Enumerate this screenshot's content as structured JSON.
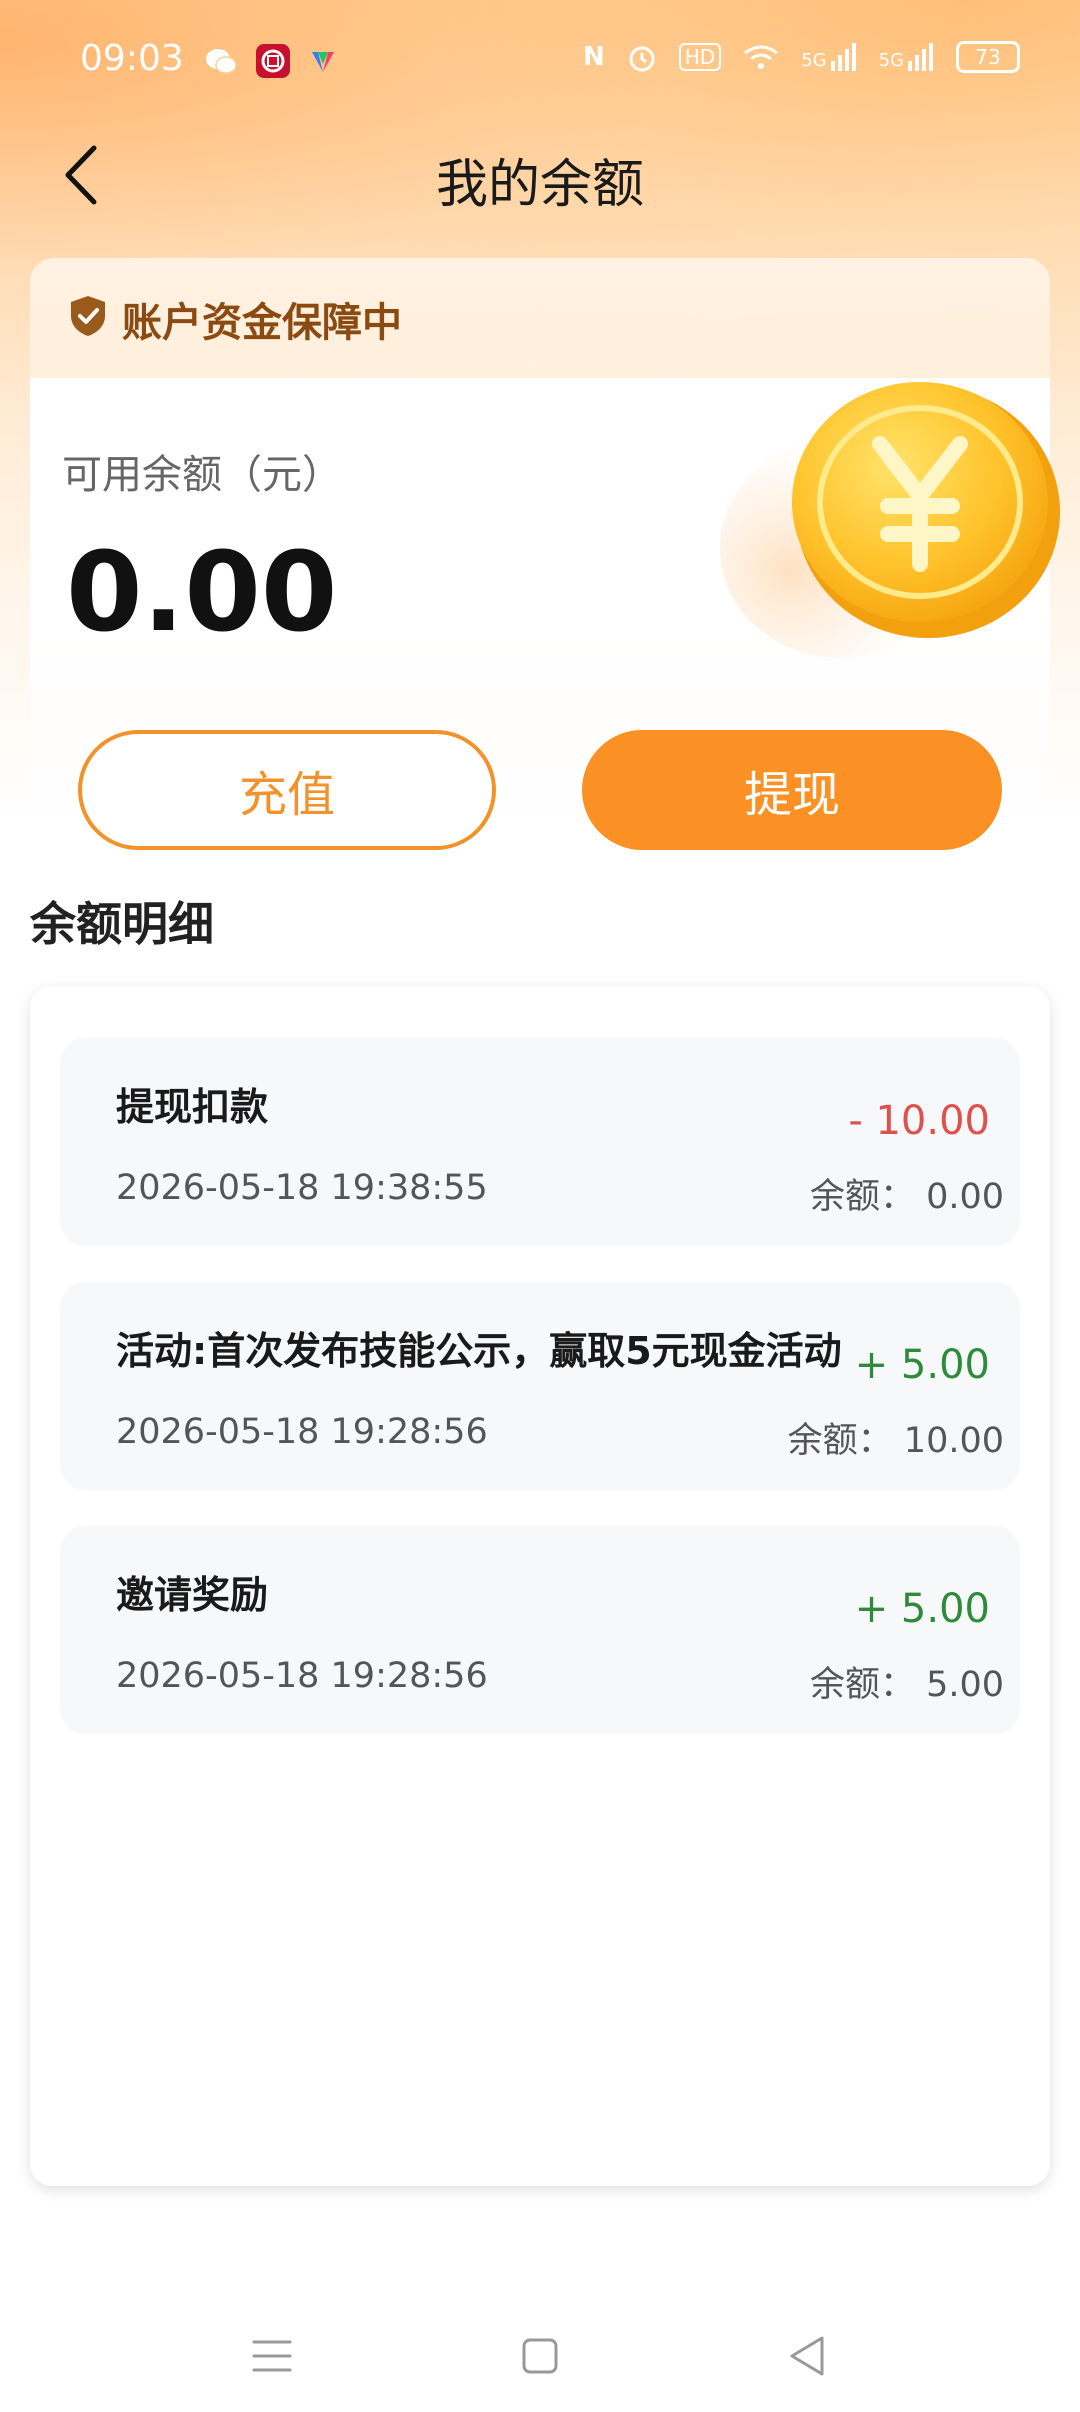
{
  "status_bar": {
    "time": "09:03",
    "battery": "73",
    "icons": [
      "wechat-icon",
      "app-icon",
      "colorful-app-icon",
      "nfc-icon",
      "alarm-icon",
      "hd-icon",
      "wifi-icon",
      "signal-5g-icon",
      "signal-5g-icon"
    ],
    "network_label_1": "5G",
    "network_label_2": "5G",
    "hd_label": "HD"
  },
  "header": {
    "title": "我的余额"
  },
  "balance_card": {
    "guarantee_text": "账户资金保障中",
    "label": "可用余额（元）",
    "amount": "0.00",
    "recharge_label": "充值",
    "withdraw_label": "提现"
  },
  "details": {
    "section_title": "余额明细",
    "items": [
      {
        "title": "提现扣款",
        "datetime": "2026-05-18 19:38:55",
        "amount": "- 10.00",
        "balance": "余额：  0.00",
        "type": "negative"
      },
      {
        "title": "活动:首次发布技能公示，赢取5元现金活动",
        "datetime": "2026-05-18 19:28:56",
        "amount": "+ 5.00",
        "balance": "余额：  10.00",
        "type": "positive"
      },
      {
        "title": "邀请奖励",
        "datetime": "2026-05-18 19:28:56",
        "amount": "+ 5.00",
        "balance": "余额：  5.00",
        "type": "positive"
      }
    ]
  },
  "colors": {
    "accent": "#fb9025",
    "negative": "#e0504c",
    "positive": "#2f8a3a"
  }
}
